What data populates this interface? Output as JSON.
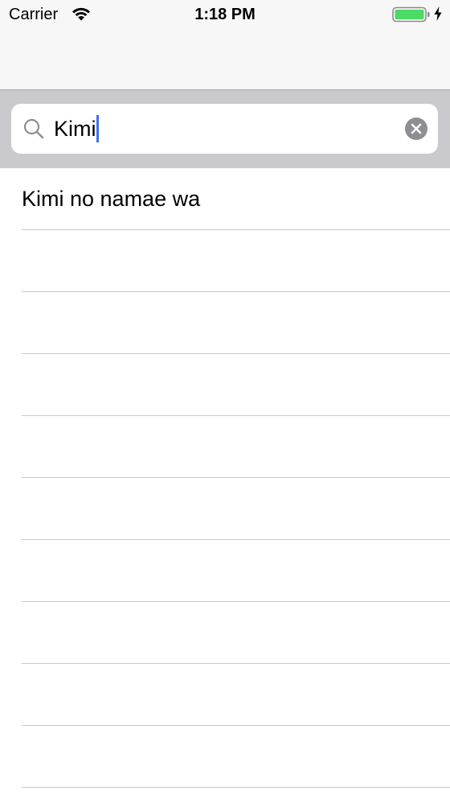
{
  "status_bar": {
    "carrier": "Carrier",
    "time": "1:18 PM",
    "battery_color": "#4cd964"
  },
  "search": {
    "value": "Kimi",
    "caret_color": "#3b6ff5",
    "icons": {
      "search": "magnifier-icon",
      "clear": "clear-x-circle-icon"
    }
  },
  "results": {
    "items": [
      {
        "label": "Kimi no namae wa"
      },
      {
        "label": ""
      },
      {
        "label": ""
      },
      {
        "label": ""
      },
      {
        "label": ""
      },
      {
        "label": ""
      },
      {
        "label": ""
      },
      {
        "label": ""
      },
      {
        "label": ""
      },
      {
        "label": ""
      }
    ]
  }
}
